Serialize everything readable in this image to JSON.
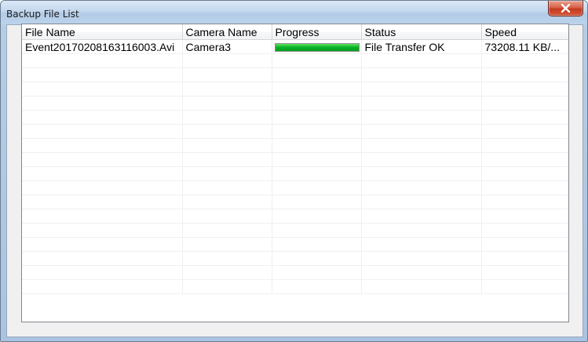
{
  "window": {
    "title": "Backup File List"
  },
  "table": {
    "columns": [
      "File Name",
      "Camera Name",
      "Progress",
      "Status",
      "Speed"
    ],
    "rows": [
      {
        "file_name": "Event20170208163116003.Avi",
        "camera_name": "Camera3",
        "progress": 1.0,
        "status": "File Transfer OK",
        "speed": "73208.11 KB/..."
      }
    ],
    "empty_row_count": 17
  },
  "colors": {
    "progress_green": "#06b025",
    "close_button_red": "#c4391e"
  },
  "icons": {
    "close": "close-x-icon"
  }
}
